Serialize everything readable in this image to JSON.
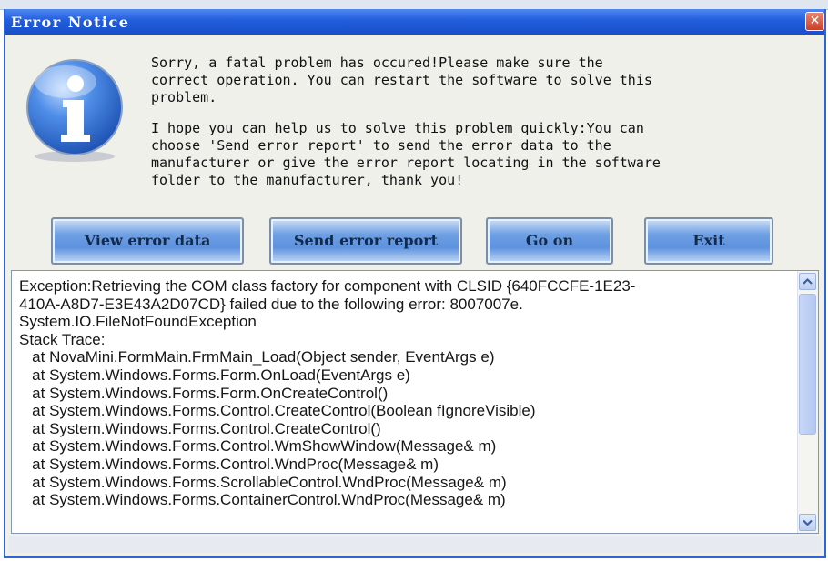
{
  "window": {
    "title": "Error Notice",
    "close_label": "✕",
    "icon": "info-icon"
  },
  "message": {
    "paragraph1": "Sorry, a fatal problem has occured!Please make sure the\ncorrect operation. You can restart the software to solve this\nproblem.",
    "paragraph2": "I hope you can help us to solve this problem quickly:You can\nchoose 'Send error report' to send the error data to the\nmanufacturer or give the error report locating in the software\nfolder to the manufacturer, thank you!"
  },
  "buttons": {
    "view_error_data": "View error data",
    "send_error_report": "Send error report",
    "go_on": "Go on",
    "exit": "Exit"
  },
  "log": {
    "lines": [
      "Exception:Retrieving the COM class factory for component with CLSID {640FCCFE-1E23-",
      "410A-A8D7-E3E43A2D07CD} failed due to the following error: 8007007e.",
      "System.IO.FileNotFoundException",
      "Stack Trace:",
      "   at NovaMini.FormMain.FrmMain_Load(Object sender, EventArgs e)",
      "   at System.Windows.Forms.Form.OnLoad(EventArgs e)",
      "   at System.Windows.Forms.Form.OnCreateControl()",
      "   at System.Windows.Forms.Control.CreateControl(Boolean fIgnoreVisible)",
      "   at System.Windows.Forms.Control.CreateControl()",
      "   at System.Windows.Forms.Control.WmShowWindow(Message& m)",
      "   at System.Windows.Forms.Control.WndProc(Message& m)",
      "   at System.Windows.Forms.ScrollableControl.WndProc(Message& m)",
      "   at System.Windows.Forms.ContainerControl.WndProc(Message& m)"
    ]
  },
  "colors": {
    "titlebar": "#215ddc",
    "button": "#6fa0e4",
    "icon": "#2a63c9"
  }
}
